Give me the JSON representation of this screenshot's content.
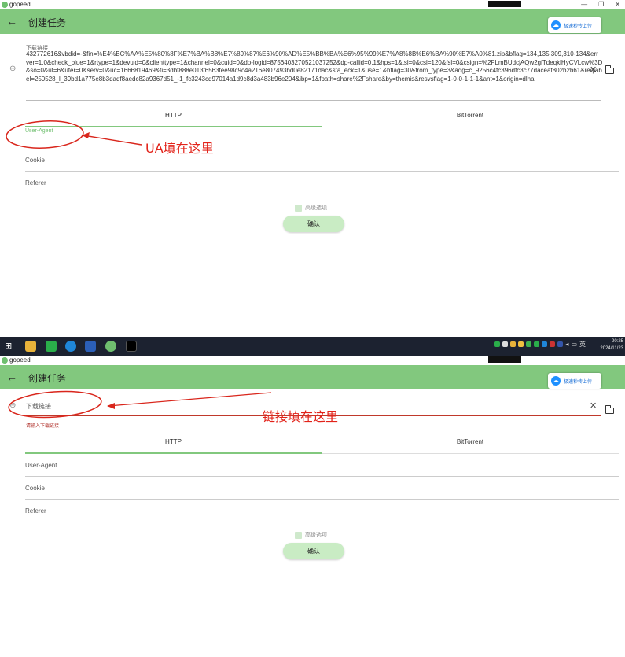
{
  "app": {
    "name": "gopeed",
    "window_controls": [
      "—",
      "❐",
      "✕"
    ]
  },
  "appbar": {
    "back_glyph": "←",
    "title": "创建任务"
  },
  "upload_badge": {
    "text": "极速秒传上传"
  },
  "form": {
    "link_label": "下载链接",
    "link_value": "432772616&vbdid=-&fin=%E4%BC%AA%E5%80%8F%E7%BA%B8%E7%89%87%E6%90%AD%E5%BB%BA%E6%95%99%E7%A8%8B%E6%BA%90%E7%A0%81.zip&bflag=134,135,309,310-134&err_ver=1.0&check_blue=1&rtype=1&devuid=0&clienttype=1&channel=0&cuid=0&dp-logid=8756403270521037252&dp-callid=0.1&hps=1&tsl=0&csl=120&fsl=0&csign=%2FLmBUdcjAQw2giTdeqklHyCVLcw%3D&so=0&ut=6&uter=0&serv=0&uc=1666819469&ti=3dbf888e013f6563fee98c9c4a216e807493bd0e82171dac&sta_eck=1&use=1&hflag=30&from_type=3&adg=c_9256c4fc396dfc3c77daceaf802b2b61&reqlabel=250528_l_39bd1a775e8b3dadf8aedc82a9367d51_-1_fc3243cd97014a1d9c8d3a483b96e204&ibp=1&fpath=share%2Fshare&by=themis&resvsflag=1-0-0-1-1-1&ant=1&origin=dlna",
    "link_placeholder": "下载链接",
    "link_error": "请输入下载链接",
    "tabs": [
      "HTTP",
      "BitTorrent"
    ],
    "fields": {
      "user_agent": "User-Agent",
      "cookie": "Cookie",
      "referer": "Referer"
    },
    "advanced_label": "高级选项",
    "confirm_label": "确认"
  },
  "annotations": {
    "ua": "UA填在这里",
    "link": "链接填在这里"
  },
  "taskbar": {
    "ime": "英",
    "time": "20:25",
    "date": "2024/11/23"
  },
  "colors": {
    "accent": "#82c87e",
    "annotation": "#e2231a",
    "error": "#c0392b"
  },
  "icons": [
    "back-arrow-icon",
    "link-icon",
    "close-icon",
    "folder-icon",
    "cloud-upload-icon",
    "windows-start-icon"
  ]
}
